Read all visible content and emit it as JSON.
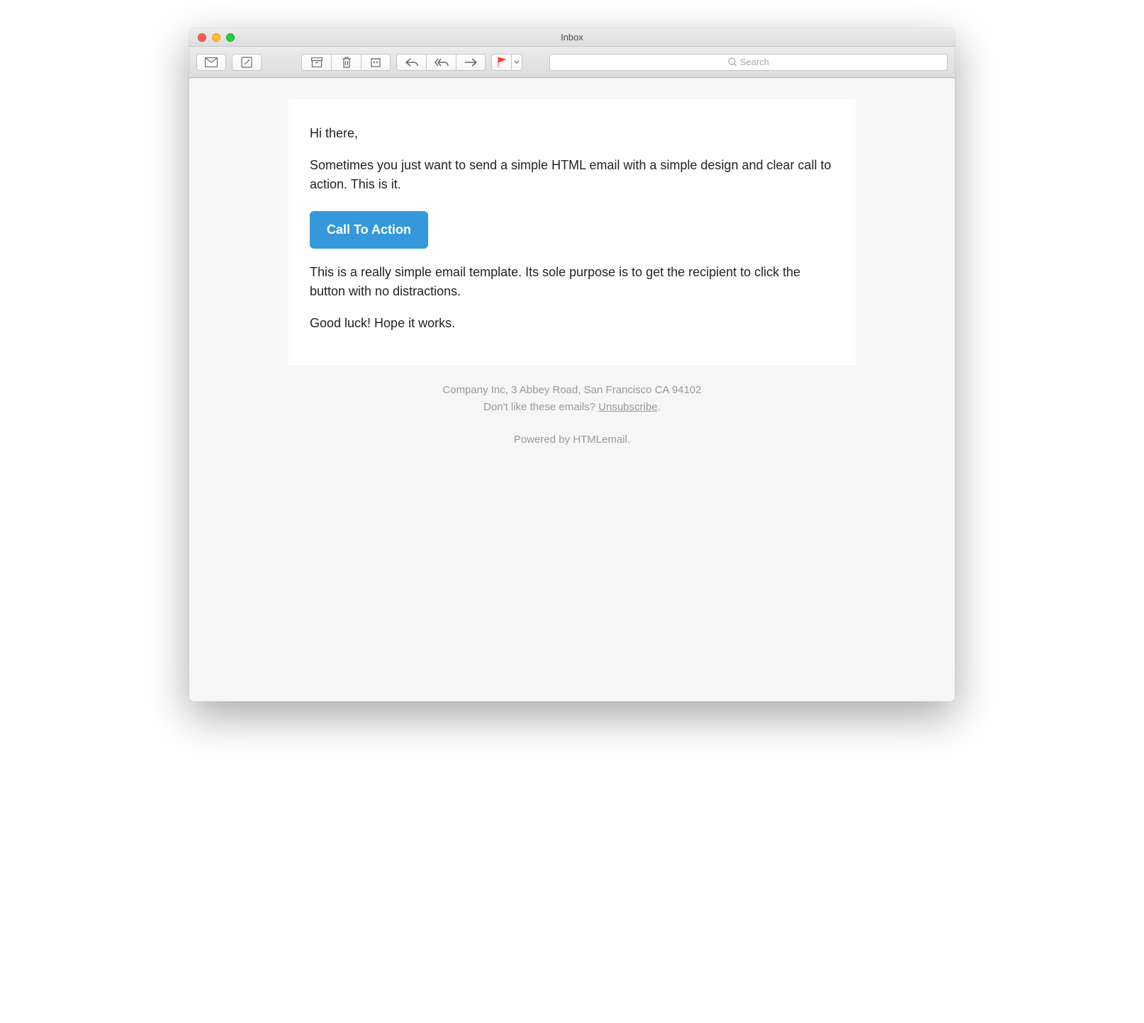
{
  "window": {
    "title": "Inbox"
  },
  "search": {
    "placeholder": "Search"
  },
  "email": {
    "greeting": "Hi there,",
    "para1": "Sometimes you just want to send a simple HTML email with a simple design and clear call to action. This is it.",
    "cta_label": "Call To Action",
    "para2": "This is a really simple email template. Its sole purpose is to get the recipient to click the button with no distractions.",
    "signoff": "Good luck! Hope it works."
  },
  "footer": {
    "company_line": "Company Inc, 3 Abbey Road, San Francisco CA 94102",
    "unsub_prefix": "Don't like these emails? ",
    "unsub_link": "Unsubscribe",
    "unsub_suffix": ".",
    "powered_prefix": "Powered by ",
    "powered_name": "HTMLemail",
    "powered_suffix": "."
  },
  "colors": {
    "cta": "#3498db",
    "background": "#f6f6f6"
  }
}
